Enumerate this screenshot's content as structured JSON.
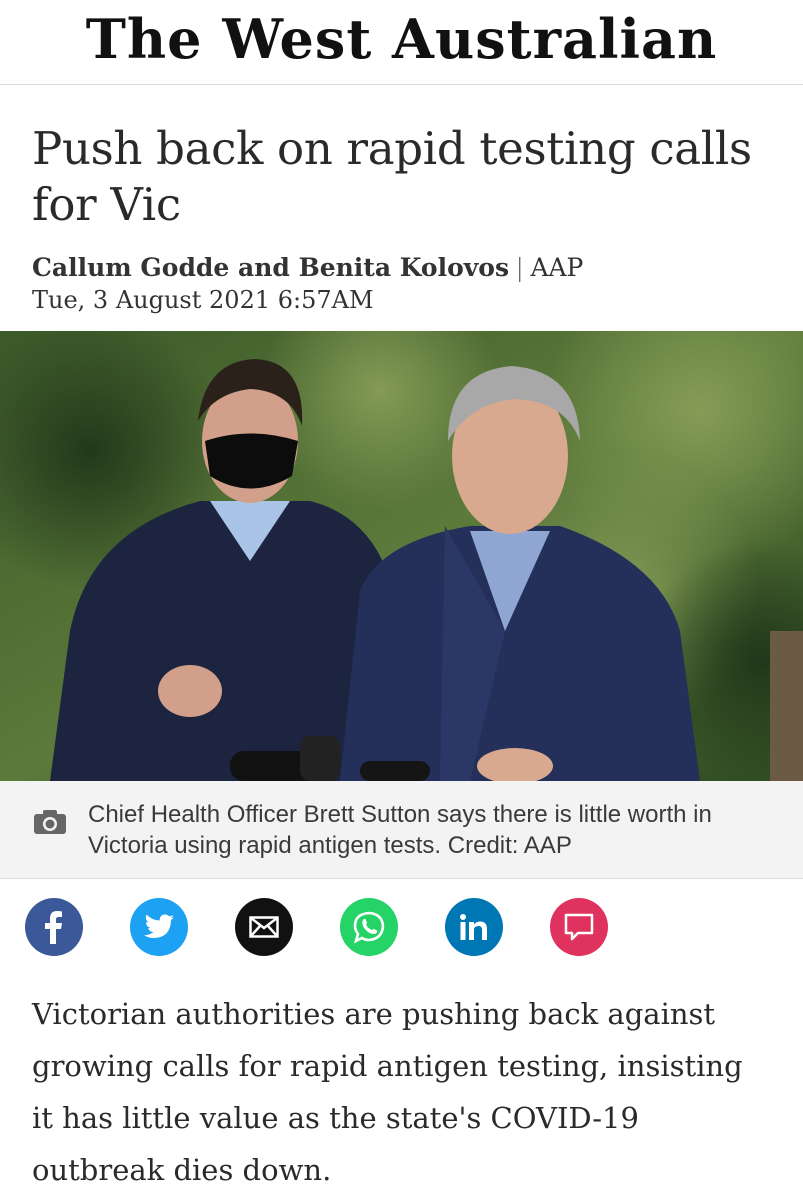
{
  "masthead": {
    "title": "The West Australian"
  },
  "article": {
    "headline": "Push back on rapid testing calls for Vic",
    "authors": "Callum Godde and Benita Kolovos",
    "separator": "|",
    "source": "AAP",
    "date": "Tue, 3 August 2021 6:57AM",
    "photo": {
      "icon": "camera-icon"
    },
    "caption": "Chief Health Officer Brett Sutton says there is little worth in Victoria using rapid antigen tests. Credit: AAP",
    "body": "Victorian authorities are pushing back against growing calls for rapid antigen testing, insisting it has little value as the state's COVID-19 outbreak dies down."
  },
  "share": [
    {
      "icon": "facebook-icon",
      "color": "#3b5998"
    },
    {
      "icon": "twitter-icon",
      "color": "#1da1f2"
    },
    {
      "icon": "email-icon",
      "color": "#111111"
    },
    {
      "icon": "whatsapp-icon",
      "color": "#25d366"
    },
    {
      "icon": "linkedin-icon",
      "color": "#0077b5"
    },
    {
      "icon": "comment-icon",
      "color": "#e0325e"
    }
  ]
}
